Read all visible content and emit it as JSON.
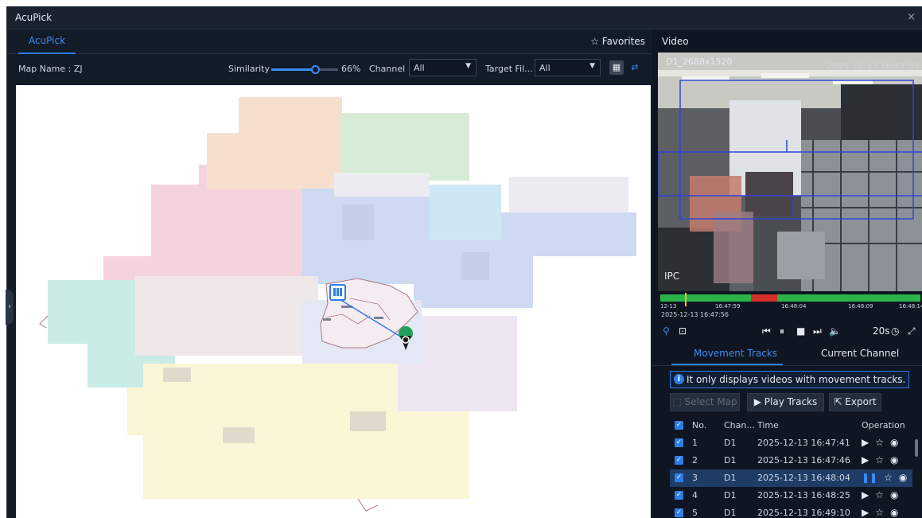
{
  "window": {
    "title": "AcuPick",
    "close_icon": "×"
  },
  "tabs": [
    {
      "label": "AcuPick",
      "active": true
    }
  ],
  "favorites_label": "Favorites",
  "filters": {
    "map_name": "Map Name : ZJ",
    "similarity_label": "Similarity",
    "similarity_value": "66%",
    "similarity_fraction": 0.66,
    "channel_label": "Channel",
    "channel_value": "All",
    "target_label": "Target Fil...",
    "target_value": "All"
  },
  "video": {
    "title": "Video",
    "resolution": "D1_2688x1520",
    "timestamp": "2025-12-13 16:47:55",
    "overlay_label": "IPC",
    "timeline": {
      "ticks": [
        "12-13",
        "16:47:59",
        "16:48:04",
        "16:48:09",
        "16:48:14"
      ],
      "current": "2025-12-13 16:47:56"
    },
    "speed": "20s"
  },
  "subtabs": [
    "Movement Tracks",
    "Current Channel"
  ],
  "info_message": "It only displays videos with movement tracks.",
  "buttons": {
    "select_map": "Select Map",
    "play_tracks": "Play Tracks",
    "export": "Export"
  },
  "table": {
    "headers": {
      "no": "No.",
      "channel": "Chan...",
      "time": "Time",
      "operation": "Operation"
    },
    "rows": [
      {
        "no": "1",
        "channel": "D1",
        "time": "2025-12-13 16:47:41",
        "playing": false
      },
      {
        "no": "2",
        "channel": "D1",
        "time": "2025-12-13 16:47:46",
        "playing": false
      },
      {
        "no": "3",
        "channel": "D1",
        "time": "2025-12-13 16:48:04",
        "playing": true
      },
      {
        "no": "4",
        "channel": "D1",
        "time": "2025-12-13 16:48:25",
        "playing": false
      },
      {
        "no": "5",
        "channel": "D1",
        "time": "2025-12-13 16:49:10",
        "playing": false
      }
    ]
  },
  "colors": {
    "accent": "#2e7de9",
    "panel": "#121b28",
    "timeline_ok": "#2bb34a",
    "timeline_alarm": "#d42d2d",
    "marker": "#f4c21a"
  }
}
